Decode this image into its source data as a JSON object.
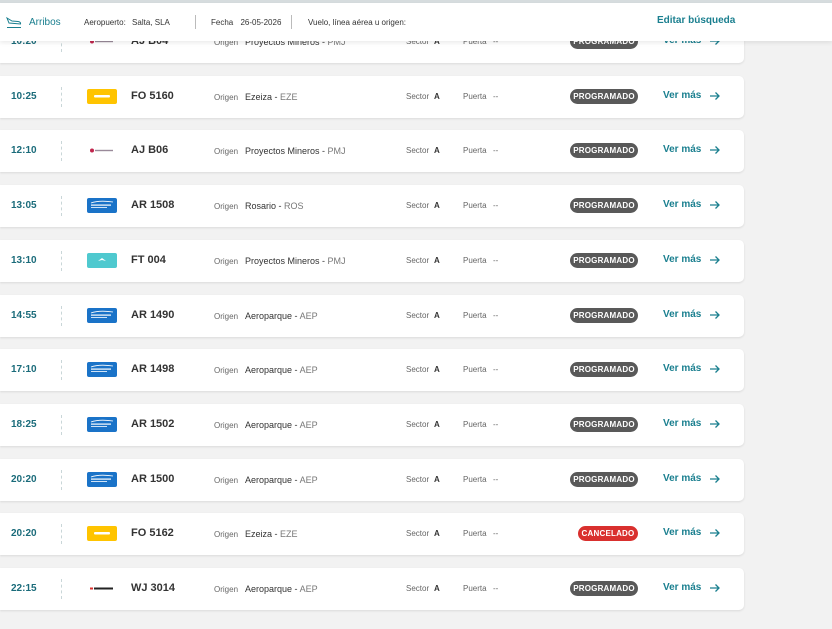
{
  "header": {
    "tab_label": "Arribos",
    "airport_key": "Aeropuerto:",
    "airport_value": "Salta, SLA",
    "date_key": "Fecha",
    "date_value": "26-05-2026",
    "search_placeholder": "Vuelo, línea aérea u origen:",
    "edit_label": "Editar búsqueda"
  },
  "labels": {
    "origin": "Origen",
    "sector": "Sector",
    "gate": "Puerta",
    "more": "Ver más"
  },
  "colors": {
    "accent": "#1a7f8f",
    "scheduled": "#595959",
    "cancelled": "#d9302e"
  },
  "flights": [
    {
      "time": "10:20",
      "airline": "andes-lineas-aereas",
      "flight": "AJ B04",
      "city": "Proyectos Mineros",
      "code": "PMJ",
      "sector": "A",
      "gate": "--",
      "status": "PROGRAMADO"
    },
    {
      "time": "10:25",
      "airline": "flybondi",
      "flight": "FO 5160",
      "city": "Ezeiza",
      "code": "EZE",
      "sector": "A",
      "gate": "--",
      "status": "PROGRAMADO"
    },
    {
      "time": "12:10",
      "airline": "andes-lineas-aereas",
      "flight": "AJ B06",
      "city": "Proyectos Mineros",
      "code": "PMJ",
      "sector": "A",
      "gate": "--",
      "status": "PROGRAMADO"
    },
    {
      "time": "13:05",
      "airline": "aerolineas-argentinas",
      "flight": "AR 1508",
      "city": "Rosario",
      "code": "ROS",
      "sector": "A",
      "gate": "--",
      "status": "PROGRAMADO"
    },
    {
      "time": "13:10",
      "airline": "flyest",
      "flight": "FT 004",
      "city": "Proyectos Mineros",
      "code": "PMJ",
      "sector": "A",
      "gate": "--",
      "status": "PROGRAMADO"
    },
    {
      "time": "14:55",
      "airline": "aerolineas-argentinas",
      "flight": "AR 1490",
      "city": "Aeroparque",
      "code": "AEP",
      "sector": "A",
      "gate": "--",
      "status": "PROGRAMADO"
    },
    {
      "time": "17:10",
      "airline": "aerolineas-argentinas",
      "flight": "AR 1498",
      "city": "Aeroparque",
      "code": "AEP",
      "sector": "A",
      "gate": "--",
      "status": "PROGRAMADO"
    },
    {
      "time": "18:25",
      "airline": "aerolineas-argentinas",
      "flight": "AR 1502",
      "city": "Aeroparque",
      "code": "AEP",
      "sector": "A",
      "gate": "--",
      "status": "PROGRAMADO"
    },
    {
      "time": "20:20",
      "airline": "aerolineas-argentinas",
      "flight": "AR 1500",
      "city": "Aeroparque",
      "code": "AEP",
      "sector": "A",
      "gate": "--",
      "status": "PROGRAMADO"
    },
    {
      "time": "20:20",
      "airline": "flybondi",
      "flight": "FO 5162",
      "city": "Ezeiza",
      "code": "EZE",
      "sector": "A",
      "gate": "--",
      "status": "CANCELADO"
    },
    {
      "time": "22:15",
      "airline": "jetsmart",
      "flight": "WJ 3014",
      "city": "Aeroparque",
      "code": "AEP",
      "sector": "A",
      "gate": "--",
      "status": "PROGRAMADO"
    }
  ]
}
